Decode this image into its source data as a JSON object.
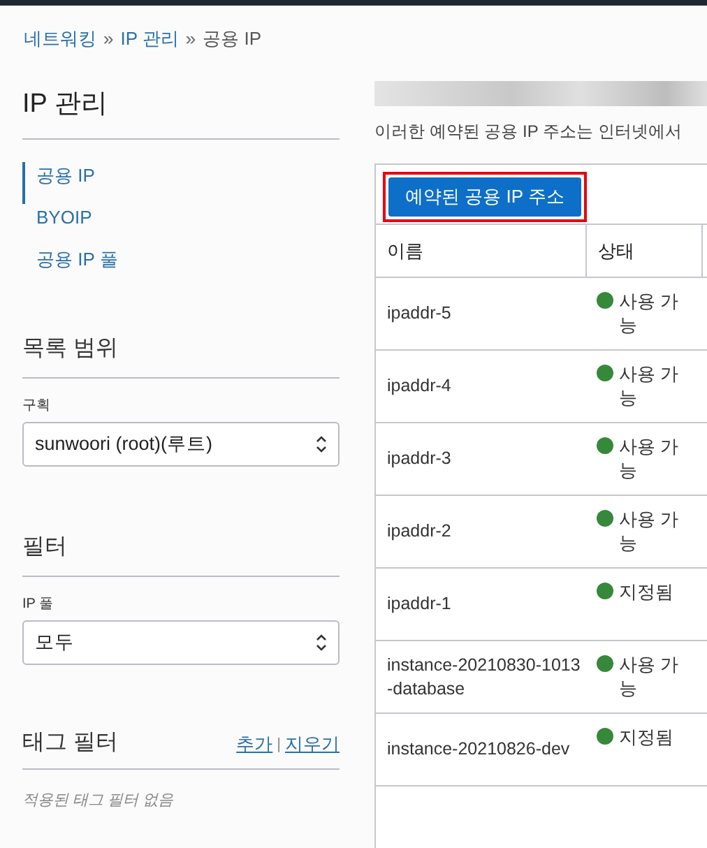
{
  "breadcrumb": [
    {
      "label": "네트워킹",
      "link": true
    },
    {
      "label": "IP 관리",
      "link": true
    },
    {
      "label": "공용 IP",
      "link": false
    }
  ],
  "breadcrumb_separator": "»",
  "sidebar": {
    "title": "IP 관리",
    "items": [
      {
        "label": "공용 IP",
        "selected": true
      },
      {
        "label": "BYOIP",
        "selected": false
      },
      {
        "label": "공용 IP 풀",
        "selected": false
      }
    ]
  },
  "scope": {
    "title": "목록 범위",
    "field_label": "구획",
    "value": "sunwoori (root)(루트)"
  },
  "filters": {
    "title": "필터",
    "field_label": "IP 풀",
    "value": "모두"
  },
  "tag_filters": {
    "title": "태그 필터",
    "add": "추가",
    "separator": "|",
    "clear": "지우기",
    "empty": "적용된 태그 필터 없음"
  },
  "description": "이러한 예약된 공용 IP 주소는 인터넷에서",
  "reserve_button": {
    "label": "예약된 공용 IP 주소",
    "highlighted": true
  },
  "table": {
    "columns": [
      "이름",
      "상태"
    ],
    "rows": [
      {
        "name": "ipaddr-5",
        "status": "사용 가능"
      },
      {
        "name": "ipaddr-4",
        "status": "사용 가능"
      },
      {
        "name": "ipaddr-3",
        "status": "사용 가능"
      },
      {
        "name": "ipaddr-2",
        "status": "사용 가능"
      },
      {
        "name": "ipaddr-1",
        "status": "지정됨"
      },
      {
        "name": "instance-20210830-1013-database",
        "status": "사용 가능"
      },
      {
        "name": "instance-20210826-dev",
        "status": "지정됨"
      }
    ]
  }
}
